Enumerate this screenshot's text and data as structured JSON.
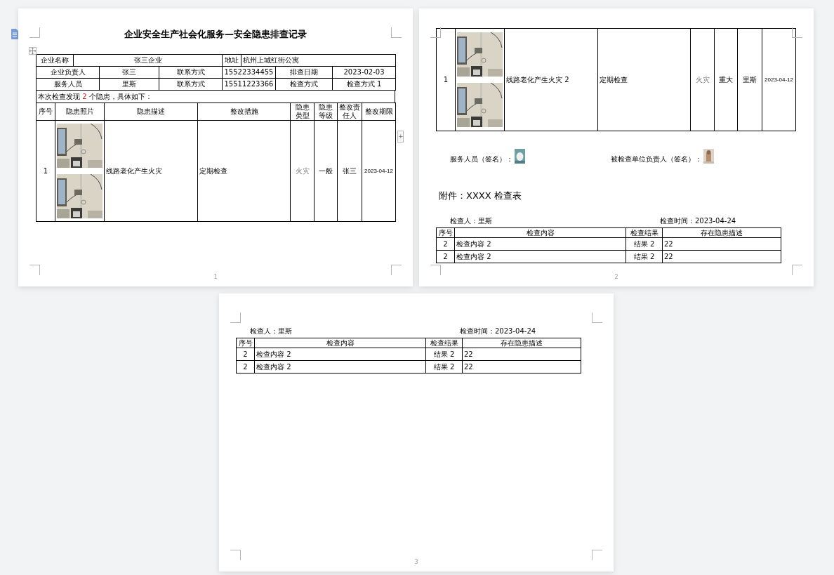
{
  "document": {
    "pages": [
      {
        "number": "1",
        "title": "企业安全生产社会化服务—安全隐患排查记录",
        "info_rows": [
          [
            {
              "text": "企业名称"
            },
            {
              "text": "张三企业"
            },
            {
              "text": "地址"
            },
            {
              "text": "杭州上城红街公寓"
            }
          ],
          [
            {
              "text": "企业负责人"
            },
            {
              "text": "张三"
            },
            {
              "text": "联系方式"
            },
            {
              "text": "15522334455"
            },
            {
              "text": "排查日期"
            },
            {
              "text": "2023-02-03"
            }
          ],
          [
            {
              "text": "服务人员"
            },
            {
              "text": "里斯"
            },
            {
              "text": "联系方式"
            },
            {
              "text": "15511223366"
            },
            {
              "text": "检查方式"
            },
            {
              "text": "检查方式 1"
            }
          ]
        ],
        "summary": {
          "before": "本次检查发现 ",
          "count": "2",
          "after": " 个隐患，具体如下："
        },
        "hazard_table": {
          "columns": [
            "序号",
            "隐患照片",
            "隐患描述",
            "整改措施",
            "隐患类型",
            "隐患等级",
            "整改责任人",
            "整改期限"
          ],
          "rows": [
            {
              "index": "1",
              "description": "线路老化产生火灾",
              "measure": "定期检查",
              "type": "火灾",
              "level": "一般",
              "owner": "张三",
              "deadline": "2023-04-12"
            }
          ]
        },
        "add_button": "+"
      },
      {
        "number": "2",
        "hazard_table": {
          "rows": [
            {
              "index": "1",
              "description": "线路老化产生火灾 2",
              "measure": "定期检查",
              "type": "火灾",
              "level": "重大",
              "owner": "里斯",
              "deadline": "2023-04-12"
            }
          ]
        },
        "signatures": [
          {
            "label": "服务人员（签名）："
          },
          {
            "label": "被检查单位负责人（签名）："
          }
        ],
        "appendix_title": "附件：XXXX 检查表",
        "checklist": {
          "inspector": "检查人：里斯",
          "time": "检查时间：2023-04-24",
          "columns": [
            "序号",
            "检查内容",
            "检查结果",
            "存在隐患描述"
          ],
          "rows": [
            [
              "2",
              "检查内容 2",
              "结果 2",
              "22"
            ],
            [
              "2",
              "检查内容 2",
              "结果 2",
              "22"
            ]
          ]
        }
      },
      {
        "number": "3",
        "checklist": {
          "inspector": "检查人：里斯",
          "time": "检查时间：2023-04-24",
          "columns": [
            "序号",
            "检查内容",
            "检查结果",
            "存在隐患描述"
          ],
          "rows": [
            [
              "2",
              "检查内容 2",
              "结果 2",
              "22"
            ],
            [
              "2",
              "检查内容 2",
              "结果 2",
              "22"
            ]
          ]
        }
      }
    ]
  }
}
